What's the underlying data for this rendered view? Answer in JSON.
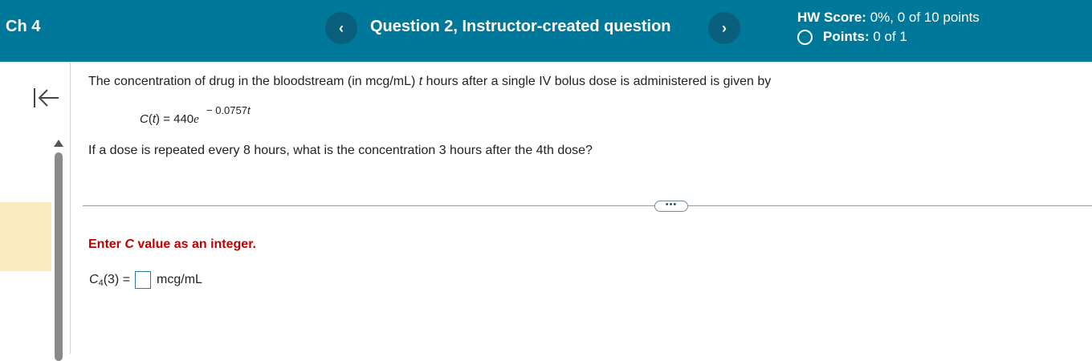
{
  "header": {
    "chapter": "Ch 4",
    "question_title": "Question 2, Instructor-created question",
    "prev_icon": "chevron-left-icon",
    "next_icon": "chevron-right-icon",
    "hw_score_label": "HW Score:",
    "hw_score_value": "0%, 0 of 10 points",
    "points_label": "Points:",
    "points_value": "0 of 1",
    "colors": {
      "bar": "#00789a",
      "nav_button": "#0a5f7c"
    }
  },
  "sidebar": {
    "collapse_icon": "collapse-left-icon",
    "highlight_color": "#faedbf"
  },
  "question": {
    "text_part1": "The concentration of drug in the bloodstream (in mcg/mL) ",
    "text_var": "t",
    "text_part2": " hours after a single IV bolus dose is administered is given by",
    "formula_lhs_func": "C",
    "formula_lhs_arg": "t",
    "formula_eq": " = 440",
    "formula_base": "e",
    "formula_exponent_coef": "− 0.0757",
    "formula_exponent_var": "t",
    "question_text": "If a dose is repeated every 8 hours, what is the concentration 3 hours after the 4th dose?"
  },
  "answer": {
    "more_label": "•••",
    "instruction_part1": "Enter ",
    "instruction_var": "C",
    "instruction_part2": " value as an integer.",
    "lhs_func": "C",
    "lhs_sub": "4",
    "lhs_arg": "(3) =",
    "input_value": "",
    "unit": "mcg/mL",
    "instruction_color": "#c00000"
  }
}
